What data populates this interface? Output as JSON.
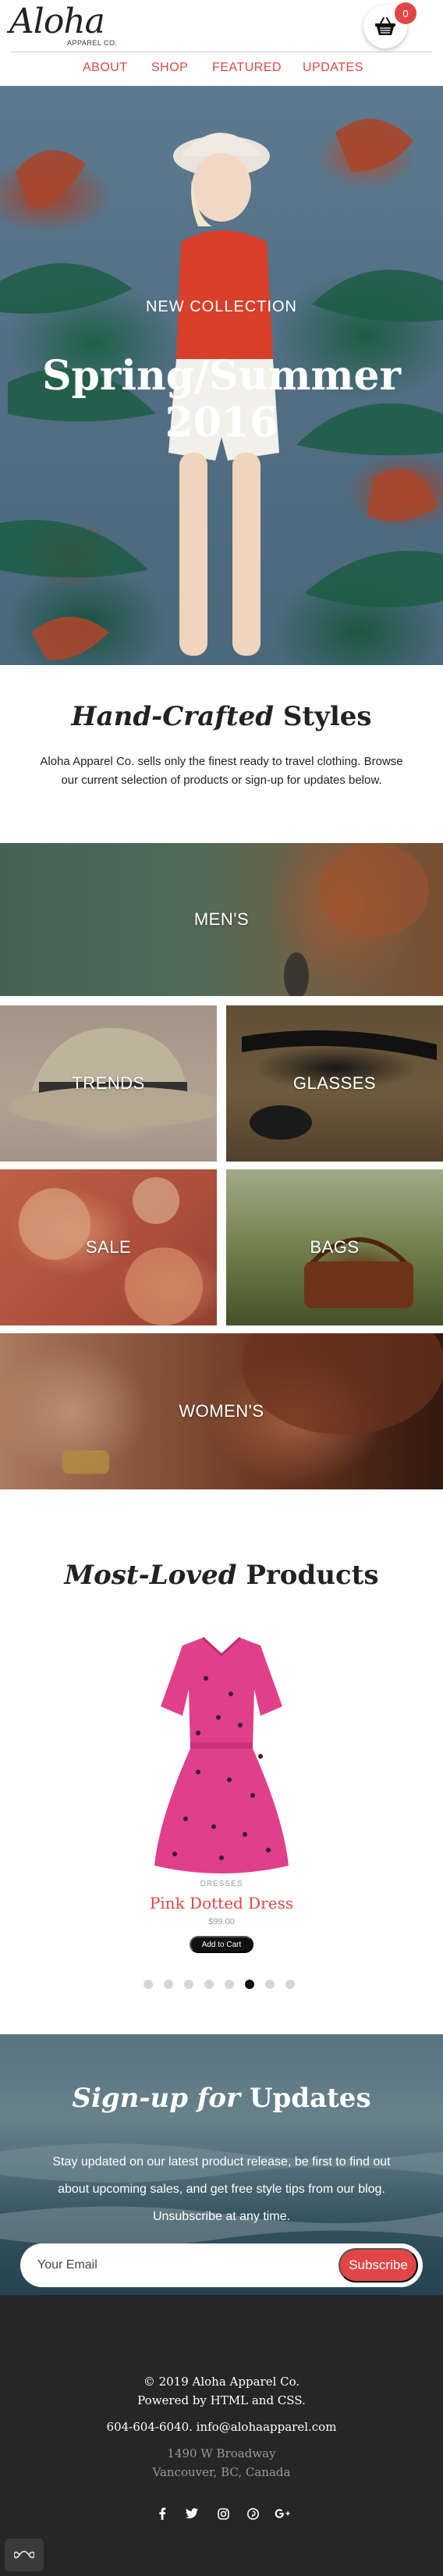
{
  "brand": {
    "name": "Aloha",
    "tagline": "APPAREL CO."
  },
  "cart": {
    "count": "0",
    "icon": "shopping-basket-icon"
  },
  "nav": {
    "items": [
      "ABOUT",
      "SHOP",
      "FEATURED",
      "UPDATES"
    ]
  },
  "hero": {
    "eyebrow": "NEW COLLECTION",
    "title_line1": "Spring/Summer",
    "title_line2": "2016"
  },
  "intro": {
    "title_italic": "Hand-Crafted",
    "title_bold": "Styles",
    "text": "Aloha Apparel Co. sells only the finest ready to travel clothing. Browse our current selection of products or sign-up for updates below."
  },
  "categories": {
    "men": "MEN'S",
    "trends": "TRENDS",
    "glasses": "GLASSES",
    "sale": "SALE",
    "bags": "BAGS",
    "women": "WOMEN'S"
  },
  "products": {
    "title_italic": "Most-Loved",
    "title_bold": "Products",
    "featured": {
      "category": "DRESSES",
      "name": "Pink Dotted Dress",
      "price": "$99.00",
      "button": "Add to Cart"
    },
    "carousel": {
      "count": 8,
      "active_index": 5
    }
  },
  "signup": {
    "title_italic": "Sign-up for",
    "title_bold": "Updates",
    "text_line1": "Stay updated on our latest product release, be first to find out",
    "text_line2": "about upcoming sales, and get free style tips from our blog.",
    "text_line3": "Unsubscribe at any time.",
    "email_placeholder": "Your Email",
    "button": "Subscribe"
  },
  "footer": {
    "copyright": "© 2019 Aloha Apparel Co.",
    "powered": "Powered by HTML and CSS.",
    "contact": "604-604-6040. info@alohaapparel.com",
    "address_line1": "1490 W Broadway",
    "address_line2": "Vancouver, BC, Canada",
    "socials": [
      "facebook-icon",
      "twitter-icon",
      "instagram-icon",
      "pinterest-icon",
      "google-plus-icon"
    ]
  },
  "colors": {
    "accent": "#e04646",
    "dark": "#262626",
    "text": "#222222"
  }
}
